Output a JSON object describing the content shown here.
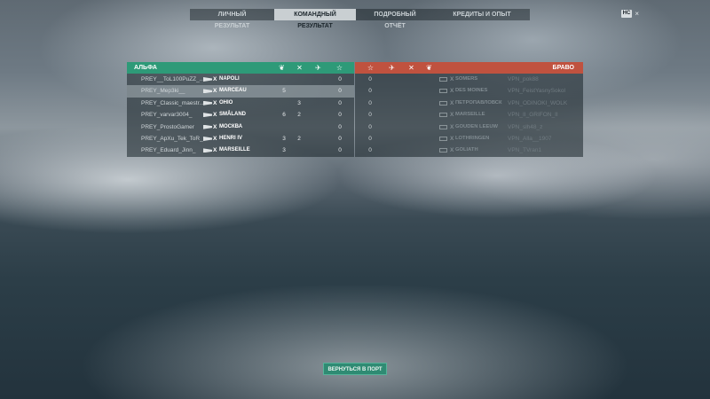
{
  "nav": {
    "tabs": [
      "ЛИЧНЫЙ РЕЗУЛЬТАТ",
      "КОМАНДНЫЙ РЕЗУЛЬТАТ",
      "ПОДРОБНЫЙ ОТЧЁТ",
      "КРЕДИТЫ И ОПЫТ"
    ],
    "active": 1
  },
  "hud": {
    "badge": "HC",
    "close": "×"
  },
  "alpha": {
    "title": "АЛЬФА",
    "color": "#2e9a78",
    "header_icons": [
      "wreath-icon",
      "swords-icon",
      "plane-icon",
      "star-icon"
    ],
    "rows": [
      {
        "player": "PREY__ToL100PuZZ_...",
        "x": "X",
        "ship": "NAPOLI",
        "c1": "",
        "c2": "",
        "c3": "",
        "c4": "0"
      },
      {
        "player": "PREY_Mep3ki__",
        "x": "X",
        "ship": "MARCEAU",
        "c1": "5",
        "c2": "",
        "c3": "",
        "c4": "0"
      },
      {
        "player": "PREY_Classic_maestr...",
        "x": "X",
        "ship": "OHIO",
        "c1": "",
        "c2": "3",
        "c3": "",
        "c4": "0"
      },
      {
        "player": "PREY_varvar3004_",
        "x": "X",
        "ship": "SMÅLAND",
        "c1": "6",
        "c2": "2",
        "c3": "",
        "c4": "0"
      },
      {
        "player": "PREY_ProstoGamer",
        "x": "X",
        "ship": "МОСКВА",
        "c1": "",
        "c2": "",
        "c3": "",
        "c4": "0"
      },
      {
        "player": "PREY_ApXu_Tek_ToR_",
        "x": "X",
        "ship": "HENRI IV",
        "c1": "3",
        "c2": "2",
        "c3": "",
        "c4": "0"
      },
      {
        "player": "PREY_Eduard_Jinn_",
        "x": "X",
        "ship": "MARSEILLE",
        "c1": "3",
        "c2": "",
        "c3": "",
        "c4": "0"
      }
    ]
  },
  "bravo": {
    "title": "БРАВО",
    "color": "#c0523f",
    "header_icons": [
      "star-icon",
      "plane-icon",
      "swords-icon",
      "wreath-icon"
    ],
    "rows": [
      {
        "score": "0",
        "x": "X",
        "ship": "SOMERS",
        "player": "VPN_pok88"
      },
      {
        "score": "0",
        "x": "X",
        "ship": "DES MOINES",
        "player": "VPN_FeistYasnySokol"
      },
      {
        "score": "0",
        "x": "X",
        "ship": "ПЕТРОПАВЛОВСК",
        "player": "VPN_ODINOKI_WOLK"
      },
      {
        "score": "0",
        "x": "X",
        "ship": "MARSEILLE",
        "player": "VPN_II_GRIFON_II"
      },
      {
        "score": "0",
        "x": "X",
        "ship": "GOUDEN LEEUW",
        "player": "VPN_slh48_z"
      },
      {
        "score": "0",
        "x": "X",
        "ship": "LOTHRINGEN",
        "player": "VPN_Alla__1907"
      },
      {
        "score": "0",
        "x": "X",
        "ship": "GOLIATH",
        "player": "VPN_TVran1"
      }
    ]
  },
  "button": {
    "return_port": "ВЕРНУТЬСЯ В ПОРТ"
  }
}
